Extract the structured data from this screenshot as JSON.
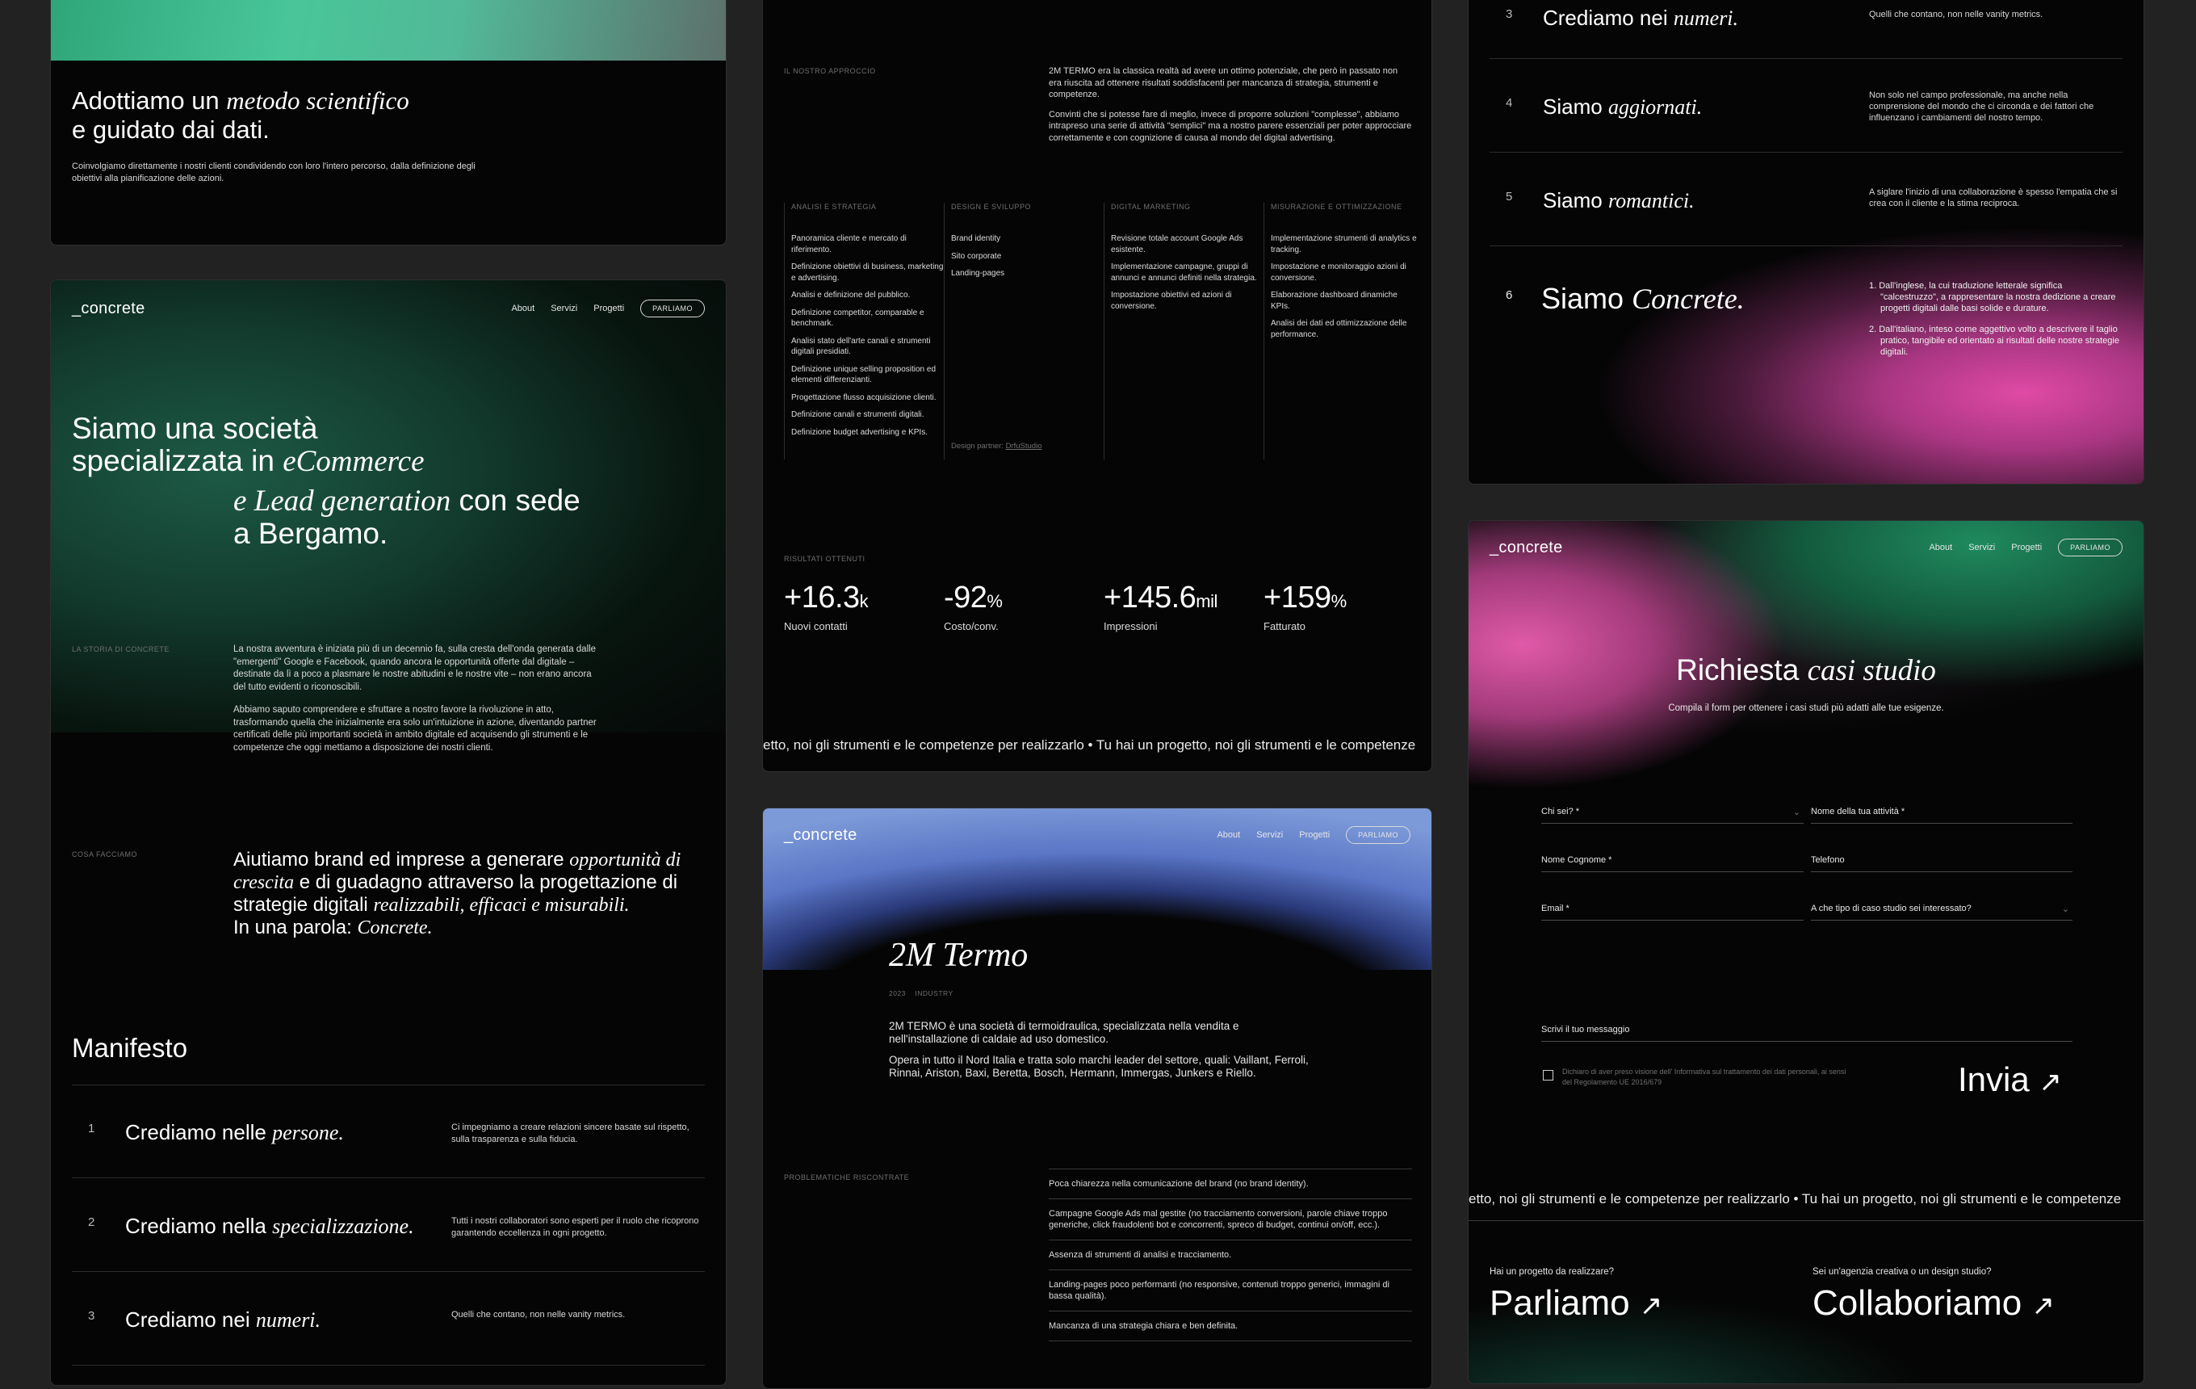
{
  "brand": {
    "logo": "_concrete"
  },
  "nav": {
    "about": "About",
    "servizi": "Servizi",
    "progetti": "Progetti",
    "cta": "PARLIAMO"
  },
  "card_a": {
    "title_plain": "Adottiamo un",
    "title_em": "metodo scientifico",
    "title_line2": "e guidato dai dati.",
    "body": "Coinvolgiamo direttamente i nostri clienti condividendo con loro l'intero percorso, dalla definizione degli obiettivi alla pianificazione delle azioni."
  },
  "home": {
    "hero_1": "Siamo una società",
    "hero_2": "specializzata in",
    "hero_em1": "eCommerce",
    "hero_em2": "e Lead generation",
    "hero_3": "con sede",
    "hero_4": "a Bergamo.",
    "story_label": "LA STORIA DI CONCRETE",
    "story_p1": "La nostra avventura è iniziata più di un decennio fa, sulla cresta dell'onda generata dalle \"emergenti\" Google e Facebook, quando ancora le opportunità offerte dal digitale – destinate da lì a poco a plasmare le nostre abitudini e le nostre vite – non erano ancora del tutto evidenti o riconoscibili.",
    "story_p2": "Abbiamo saputo comprendere e sfruttare a nostro favore la rivoluzione in atto, trasformando quella che inizialmente era solo un'intuizione in azione, diventando partner certificati delle più importanti società in ambito digitale ed acquisendo gli strumenti e le competenze che oggi mettiamo a disposizione dei nostri clienti.",
    "what_label": "COSA FACCIAMO",
    "what_1": "Aiutiamo brand ed imprese a generare",
    "what_em1": "opportunità di crescita",
    "what_2": "e di guadagno attraverso la progettazione di strategie digitali",
    "what_em2": "realizzabili, efficaci e misurabili.",
    "what_3": "In una parola:",
    "what_em3": "Concrete.",
    "manifesto_title": "Manifesto"
  },
  "manifesto": [
    {
      "n": "1",
      "plain": "Crediamo nelle",
      "em": "persone.",
      "desc": "Ci impegniamo a creare relazioni sincere basate sul rispetto, sulla trasparenza e sulla fiducia."
    },
    {
      "n": "2",
      "plain": "Crediamo nella",
      "em": "specializzazione.",
      "desc": "Tutti i nostri collaboratori sono esperti per il ruolo che ricoprono garantendo eccellenza in ogni progetto."
    },
    {
      "n": "3",
      "plain": "Crediamo nei",
      "em": "numeri.",
      "desc": "Quelli che contano, non nelle vanity metrics."
    },
    {
      "n": "4",
      "plain": "Siamo",
      "em": "aggiornati.",
      "desc": "Non solo nel campo professionale, ma anche nella comprensione del mondo che ci circonda e dei fattori che influenzano i cambiamenti del nostro tempo."
    },
    {
      "n": "5",
      "plain": "Siamo",
      "em": "romantici.",
      "desc": "A siglare l'inizio di una collaborazione è spesso l'empatia che si crea con il cliente e la stima reciproca."
    },
    {
      "n": "6",
      "plain": "Siamo",
      "em": "Concrete.",
      "desc1": "1. Dall'inglese, la cui traduzione letterale significa \"calcestruzzo\", a rappresentare la nostra dedizione a creare progetti digitali dalle basi solide e durature.",
      "desc2": "2. Dall'italiano, inteso come aggettivo volto a descrivere il taglio pratico, tangibile ed orientato ai risultati delle nostre strategie digitali."
    }
  ],
  "case": {
    "approach_label": "IL NOSTRO APPROCCIO",
    "approach_p1": "2M TERMO era la classica realtà ad avere un ottimo potenziale, che però in passato non era riuscita ad ottenere risultati soddisfacenti per mancanza di strategia, strumenti e competenze.",
    "approach_p2": "Convinti che si potesse fare di meglio, invece di proporre soluzioni \"complesse\", abbiamo intrapreso una serie di attività \"semplici\" ma a nostro parere essenziali per poter approcciare correttamente e con cognizione di causa al mondo del digital advertising.",
    "columns": [
      {
        "head": "ANALISI E STRATEGIA",
        "items": [
          "Panoramica cliente e mercato di riferimento.",
          "Definizione obiettivi di business, marketing e advertising.",
          "Analisi e definizione del pubblico.",
          "Definizione competitor, comparable e benchmark.",
          "Analisi stato dell'arte canali e strumenti digitali presidiati.",
          "Definizione unique selling proposition ed elementi differenzianti.",
          "Progettazione flusso acquisizione clienti.",
          "Definizione canali e strumenti digitali.",
          "Definizione budget advertising e KPIs."
        ]
      },
      {
        "head": "DESIGN E SVILUPPO",
        "items": [
          "Brand identity",
          "Sito corporate",
          "Landing-pages"
        ]
      },
      {
        "head": "DIGITAL MARKETING",
        "items": [
          "Revisione totale account Google Ads esistente.",
          "Implementazione campagne, gruppi di annunci e annunci definiti nella strategia.",
          "Impostazione obiettivi ed azioni di conversione."
        ]
      },
      {
        "head": "MISURAZIONE E OTTIMIZZAZIONE",
        "items": [
          "Implementazione strumenti di analytics e tracking.",
          "Impostazione e monitoraggio azioni di conversione.",
          "Elaborazione dashboard dinamiche KPIs.",
          "Analisi dei dati ed ottimizzazione delle performance."
        ]
      }
    ],
    "design_partner_label": "Design partner:",
    "design_partner": "DrfuStudio",
    "results_label": "RISULTATI OTTENUTI",
    "stats": [
      {
        "value": "+16.3",
        "unit": "k",
        "label": "Nuovi contatti"
      },
      {
        "value": "-92",
        "unit": "%",
        "label": "Costo/conv."
      },
      {
        "value": "+145.6",
        "unit": "mil",
        "label": "Impressioni"
      },
      {
        "value": "+159",
        "unit": "%",
        "label": "Fatturato"
      }
    ],
    "marquee": "etto, noi gli strumenti e le competenze per realizzarlo • Tu hai un progetto, noi gli strumenti e le competenze"
  },
  "termo": {
    "title": "2M Termo",
    "year": "2023",
    "tag": "INDUSTRY",
    "p1": "2M TERMO è una società di termoidraulica, specializzata nella vendita e nell'installazione di caldaie ad uso domestico.",
    "p2": "Opera in tutto il Nord Italia e tratta solo marchi leader del settore, quali: Vaillant, Ferroli, Rinnai, Ariston, Baxi, Beretta, Bosch, Hermann, Immergas, Junkers e Riello.",
    "problems_label": "PROBLEMATICHE RISCONTRATE",
    "problems": [
      "Poca chiarezza nella comunicazione del brand (no brand identity).",
      "Campagne Google Ads mal gestite (no tracciamento conversioni, parole chiave troppo generiche, click fraudolenti bot e concorrenti, spreco di budget, continui on/off, ecc.).",
      "Assenza di strumenti di analisi e tracciamento.",
      "Landing-pages poco performanti (no responsive, contenuti troppo generici, immagini di bassa qualità).",
      "Mancanza di una strategia chiara e ben definita."
    ]
  },
  "request": {
    "title_plain": "Richiesta",
    "title_em": "casi studio",
    "subtitle": "Compila il form per ottenere i casi studi più adatti alle tue esigenze.",
    "f_who": "Chi sei? *",
    "f_company": "Nome della tua attività *",
    "f_name": "Nome Cognome *",
    "f_phone": "Telefono",
    "f_email": "Email *",
    "f_type": "A che tipo di caso studio sei interessato?",
    "f_message": "Scrivi il tuo messaggio",
    "privacy": "Dichiaro di aver preso visione dell' Informativa sul trattamento dei dati personali, ai sensi del Regolamento UE 2016/679",
    "send": "Invia",
    "marquee": "etto, noi gli strumenti e le competenze per realizzarlo • Tu hai un progetto, noi gli strumenti e le competenze",
    "foot_q1": "Hai un progetto da realizzare?",
    "foot_cta1": "Parliamo",
    "foot_q2": "Sei un'agenzia creativa o un design studio?",
    "foot_cta2": "Collaboriamo"
  },
  "colors": {
    "bg": "#222222",
    "card": "#050505",
    "green": "#3fbf8f",
    "pink": "#e04aa6",
    "blue": "#7fa0e0"
  }
}
